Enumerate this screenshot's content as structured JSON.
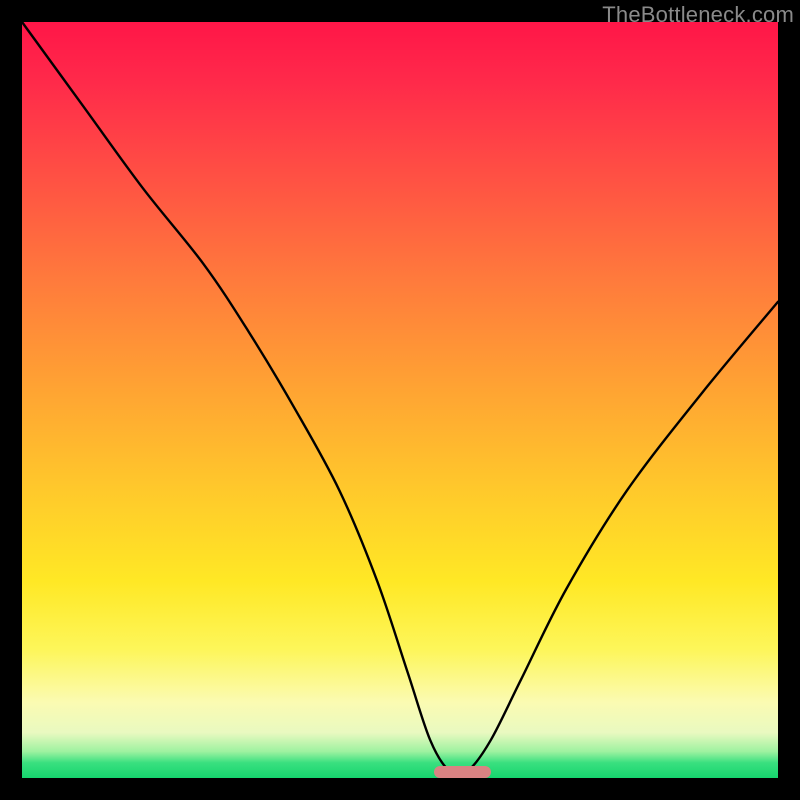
{
  "watermark": "TheBottleneck.com",
  "chart_data": {
    "type": "line",
    "title": "",
    "xlabel": "",
    "ylabel": "",
    "xlim": [
      0,
      100
    ],
    "ylim": [
      0,
      100
    ],
    "series": [
      {
        "name": "bottleneck-curve",
        "x": [
          0,
          8,
          16,
          24,
          30,
          36,
          42,
          47,
          51,
          54,
          56.5,
          59,
          62,
          66,
          72,
          80,
          90,
          100
        ],
        "values": [
          100,
          89,
          78,
          68,
          59,
          49,
          38,
          26,
          14,
          5,
          1,
          1,
          5,
          13,
          25,
          38,
          51,
          63
        ]
      }
    ],
    "marker": {
      "x_start": 54.5,
      "x_end": 62,
      "y": 0
    },
    "gradient_stops": [
      {
        "offset": 0,
        "color": "#ff1648"
      },
      {
        "offset": 0.48,
        "color": "#ffa233"
      },
      {
        "offset": 0.74,
        "color": "#ffe825"
      },
      {
        "offset": 0.98,
        "color": "#39e07f"
      },
      {
        "offset": 1.0,
        "color": "#16d46e"
      }
    ]
  }
}
